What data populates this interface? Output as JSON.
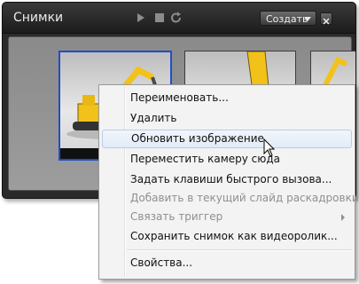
{
  "panel": {
    "title": "Снимки",
    "create_label": "Создать"
  },
  "icons": {
    "play": "play-icon",
    "stop": "stop-icon",
    "refresh": "refresh-icon",
    "dropdown": "chevron-down-icon",
    "close": "close-icon",
    "cursor": "mouse-pointer-icon"
  },
  "context_menu": {
    "items": [
      {
        "label": "Переименовать...",
        "enabled": true
      },
      {
        "label": "Удалить",
        "enabled": true
      },
      {
        "label": "Обновить изображение",
        "enabled": true,
        "highlighted": true
      },
      {
        "label": "Переместить камеру сюда",
        "enabled": true
      },
      {
        "label": "Задать клавиши быстрого вызова...",
        "enabled": true
      },
      {
        "label": "Добавить в текущий слайд раскадровки",
        "enabled": false
      },
      {
        "label": "Связать триггер",
        "enabled": false,
        "submenu": true
      },
      {
        "label": "Сохранить снимок как видеоролик...",
        "enabled": true
      },
      {
        "label": "Свойства...",
        "enabled": true
      }
    ]
  },
  "colors": {
    "selection_border": "#1f4ec9",
    "panel_bg": "#2a2a2a",
    "menu_bg": "#f3f3f3",
    "excavator": "#f2c21a"
  }
}
